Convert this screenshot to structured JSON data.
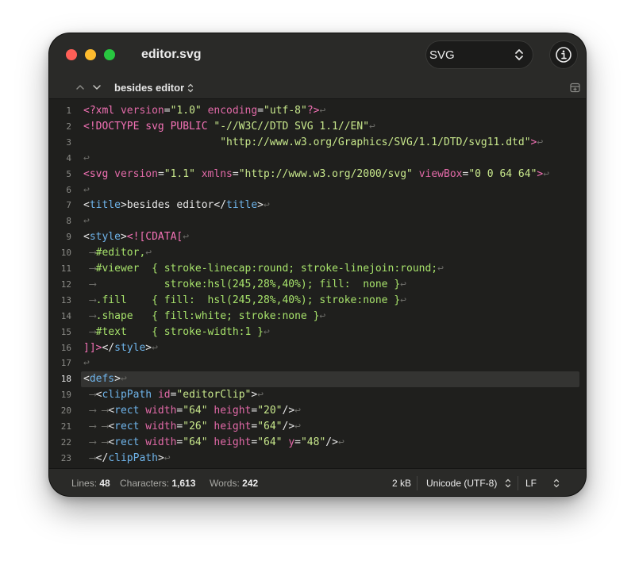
{
  "window": {
    "title": "editor.svg"
  },
  "toolbar": {
    "syntax_value": "SVG"
  },
  "navbar": {
    "current_item": "besides editor"
  },
  "colors": {
    "tag": "#f472b6",
    "attribute": "#e26aa8",
    "string": "#c8e88c",
    "selector": "#a7e26b",
    "element_name": "#6fb4ea",
    "invisible": "#6a6a66"
  },
  "editor": {
    "current_line": 18,
    "lines": [
      {
        "n": "1",
        "tokens": [
          [
            "tag",
            "<?xml "
          ],
          [
            "attr",
            "version"
          ],
          [
            "plain",
            "="
          ],
          [
            "str",
            "\"1.0\""
          ],
          [
            "plain",
            " "
          ],
          [
            "attr",
            "encoding"
          ],
          [
            "plain",
            "="
          ],
          [
            "str",
            "\"utf-8\""
          ],
          [
            "tag",
            "?>"
          ],
          [
            "ctrl",
            "↩"
          ]
        ]
      },
      {
        "n": "2",
        "tokens": [
          [
            "tag",
            "<!DOCTYPE svg PUBLIC "
          ],
          [
            "str",
            "\"-//W3C//DTD SVG 1.1//EN\""
          ],
          [
            "ctrl",
            "↩"
          ]
        ]
      },
      {
        "n": "3",
        "tokens": [
          [
            "plain",
            "                      "
          ],
          [
            "str",
            "\"http://www.w3.org/Graphics/SVG/1.1/DTD/svg11.dtd\""
          ],
          [
            "tag",
            ">"
          ],
          [
            "ctrl",
            "↩"
          ]
        ]
      },
      {
        "n": "4",
        "tokens": [
          [
            "ctrl",
            "↩"
          ]
        ]
      },
      {
        "n": "5",
        "tokens": [
          [
            "tag",
            "<svg "
          ],
          [
            "attr",
            "version"
          ],
          [
            "plain",
            "="
          ],
          [
            "str",
            "\"1.1\""
          ],
          [
            "plain",
            " "
          ],
          [
            "attr",
            "xmlns"
          ],
          [
            "plain",
            "="
          ],
          [
            "str",
            "\"http://www.w3.org/2000/svg\""
          ],
          [
            "plain",
            " "
          ],
          [
            "attr",
            "viewBox"
          ],
          [
            "plain",
            "="
          ],
          [
            "str",
            "\"0 0 64 64\""
          ],
          [
            "tag",
            ">"
          ],
          [
            "ctrl",
            "↩"
          ]
        ]
      },
      {
        "n": "6",
        "tokens": [
          [
            "ctrl",
            "↩"
          ]
        ]
      },
      {
        "n": "7",
        "tokens": [
          [
            "plain",
            "<"
          ],
          [
            "name",
            "title"
          ],
          [
            "plain",
            ">besides editor</"
          ],
          [
            "name",
            "title"
          ],
          [
            "plain",
            ">"
          ],
          [
            "ctrl",
            "↩"
          ]
        ]
      },
      {
        "n": "8",
        "tokens": [
          [
            "ctrl",
            "↩"
          ]
        ]
      },
      {
        "n": "9",
        "tokens": [
          [
            "plain",
            "<"
          ],
          [
            "name",
            "style"
          ],
          [
            "plain",
            ">"
          ],
          [
            "tag",
            "<![CDATA["
          ],
          [
            "ctrl",
            "↩"
          ]
        ]
      },
      {
        "n": "10",
        "tokens": [
          [
            "ctrl",
            " ⟶"
          ],
          [
            "sel",
            "#editor,"
          ],
          [
            "ctrl",
            "↩"
          ]
        ]
      },
      {
        "n": "11",
        "tokens": [
          [
            "ctrl",
            " ⟶"
          ],
          [
            "sel",
            "#viewer  { stroke-linecap:round; stroke-linejoin:round;"
          ],
          [
            "ctrl",
            "↩"
          ]
        ]
      },
      {
        "n": "12",
        "tokens": [
          [
            "ctrl",
            " ⟶"
          ],
          [
            "sel",
            "           stroke:hsl(245,28%,40%); fill:  none }"
          ],
          [
            "ctrl",
            "↩"
          ]
        ]
      },
      {
        "n": "13",
        "tokens": [
          [
            "ctrl",
            " ⟶"
          ],
          [
            "sel",
            ".fill    { fill:  hsl(245,28%,40%); stroke:none }"
          ],
          [
            "ctrl",
            "↩"
          ]
        ]
      },
      {
        "n": "14",
        "tokens": [
          [
            "ctrl",
            " ⟶"
          ],
          [
            "sel",
            ".shape   { fill:white; stroke:none }"
          ],
          [
            "ctrl",
            "↩"
          ]
        ]
      },
      {
        "n": "15",
        "tokens": [
          [
            "ctrl",
            " ⟶"
          ],
          [
            "sel",
            "#text    { stroke-width:1 }"
          ],
          [
            "ctrl",
            "↩"
          ]
        ]
      },
      {
        "n": "16",
        "tokens": [
          [
            "tag",
            "]]>"
          ],
          [
            "plain",
            "</"
          ],
          [
            "name",
            "style"
          ],
          [
            "plain",
            ">"
          ],
          [
            "ctrl",
            "↩"
          ]
        ]
      },
      {
        "n": "17",
        "tokens": [
          [
            "ctrl",
            "↩"
          ]
        ]
      },
      {
        "n": "18",
        "tokens": [
          [
            "plain",
            "<"
          ],
          [
            "name",
            "defs"
          ],
          [
            "plain",
            ">"
          ],
          [
            "ctrl",
            "↩"
          ]
        ]
      },
      {
        "n": "19",
        "tokens": [
          [
            "ctrl",
            " ⟶"
          ],
          [
            "plain",
            "<"
          ],
          [
            "name",
            "clipPath"
          ],
          [
            "plain",
            " "
          ],
          [
            "attr",
            "id"
          ],
          [
            "plain",
            "="
          ],
          [
            "str",
            "\"editorClip\""
          ],
          [
            "plain",
            ">"
          ],
          [
            "ctrl",
            "↩"
          ]
        ]
      },
      {
        "n": "20",
        "tokens": [
          [
            "ctrl",
            " ⟶ ⟶"
          ],
          [
            "plain",
            "<"
          ],
          [
            "name",
            "rect"
          ],
          [
            "plain",
            " "
          ],
          [
            "attr",
            "width"
          ],
          [
            "plain",
            "="
          ],
          [
            "str",
            "\"64\""
          ],
          [
            "plain",
            " "
          ],
          [
            "attr",
            "height"
          ],
          [
            "plain",
            "="
          ],
          [
            "str",
            "\"20\""
          ],
          [
            "plain",
            "/>"
          ],
          [
            "ctrl",
            "↩"
          ]
        ]
      },
      {
        "n": "21",
        "tokens": [
          [
            "ctrl",
            " ⟶ ⟶"
          ],
          [
            "plain",
            "<"
          ],
          [
            "name",
            "rect"
          ],
          [
            "plain",
            " "
          ],
          [
            "attr",
            "width"
          ],
          [
            "plain",
            "="
          ],
          [
            "str",
            "\"26\""
          ],
          [
            "plain",
            " "
          ],
          [
            "attr",
            "height"
          ],
          [
            "plain",
            "="
          ],
          [
            "str",
            "\"64\""
          ],
          [
            "plain",
            "/>"
          ],
          [
            "ctrl",
            "↩"
          ]
        ]
      },
      {
        "n": "22",
        "tokens": [
          [
            "ctrl",
            " ⟶ ⟶"
          ],
          [
            "plain",
            "<"
          ],
          [
            "name",
            "rect"
          ],
          [
            "plain",
            " "
          ],
          [
            "attr",
            "width"
          ],
          [
            "plain",
            "="
          ],
          [
            "str",
            "\"64\""
          ],
          [
            "plain",
            " "
          ],
          [
            "attr",
            "height"
          ],
          [
            "plain",
            "="
          ],
          [
            "str",
            "\"64\""
          ],
          [
            "plain",
            " "
          ],
          [
            "attr",
            "y"
          ],
          [
            "plain",
            "="
          ],
          [
            "str",
            "\"48\""
          ],
          [
            "plain",
            "/>"
          ],
          [
            "ctrl",
            "↩"
          ]
        ]
      },
      {
        "n": "23",
        "tokens": [
          [
            "ctrl",
            " ⟶"
          ],
          [
            "plain",
            "</"
          ],
          [
            "name",
            "clipPath"
          ],
          [
            "plain",
            ">"
          ],
          [
            "ctrl",
            "↩"
          ]
        ]
      }
    ]
  },
  "status": {
    "lines_label": "Lines:",
    "lines_value": "48",
    "chars_label": "Characters:",
    "chars_value": "1,613",
    "words_label": "Words:",
    "words_value": "242",
    "file_size": "2 kB",
    "encoding": "Unicode (UTF-8)",
    "line_ending": "LF"
  }
}
